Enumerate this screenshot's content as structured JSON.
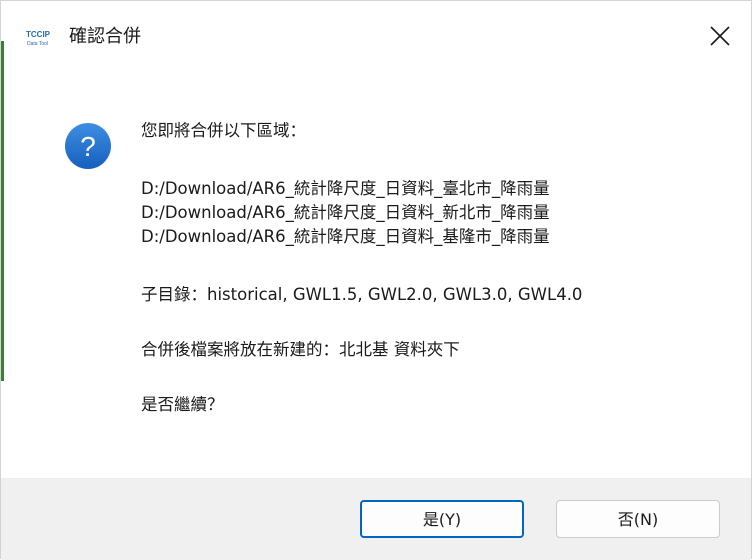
{
  "window": {
    "title": "確認合併",
    "icon": "tccip-app-icon",
    "close_icon": "close-icon"
  },
  "message": {
    "intro": "您即將合併以下區域：",
    "paths": [
      "D:/Download/AR6_統計降尺度_日資料_臺北市_降雨量",
      "D:/Download/AR6_統計降尺度_日資料_新北市_降雨量",
      "D:/Download/AR6_統計降尺度_日資料_基隆市_降雨量"
    ],
    "subdirs": "子目錄：historical, GWL1.5, GWL2.0, GWL3.0, GWL4.0",
    "destination": "合併後檔案將放在新建的：北北基 資料夾下",
    "question": "是否繼續？"
  },
  "icon": {
    "question": "question-icon",
    "color": "#1c6fcf"
  },
  "buttons": {
    "yes_label": "是(Y)",
    "no_label": "否(N)"
  }
}
